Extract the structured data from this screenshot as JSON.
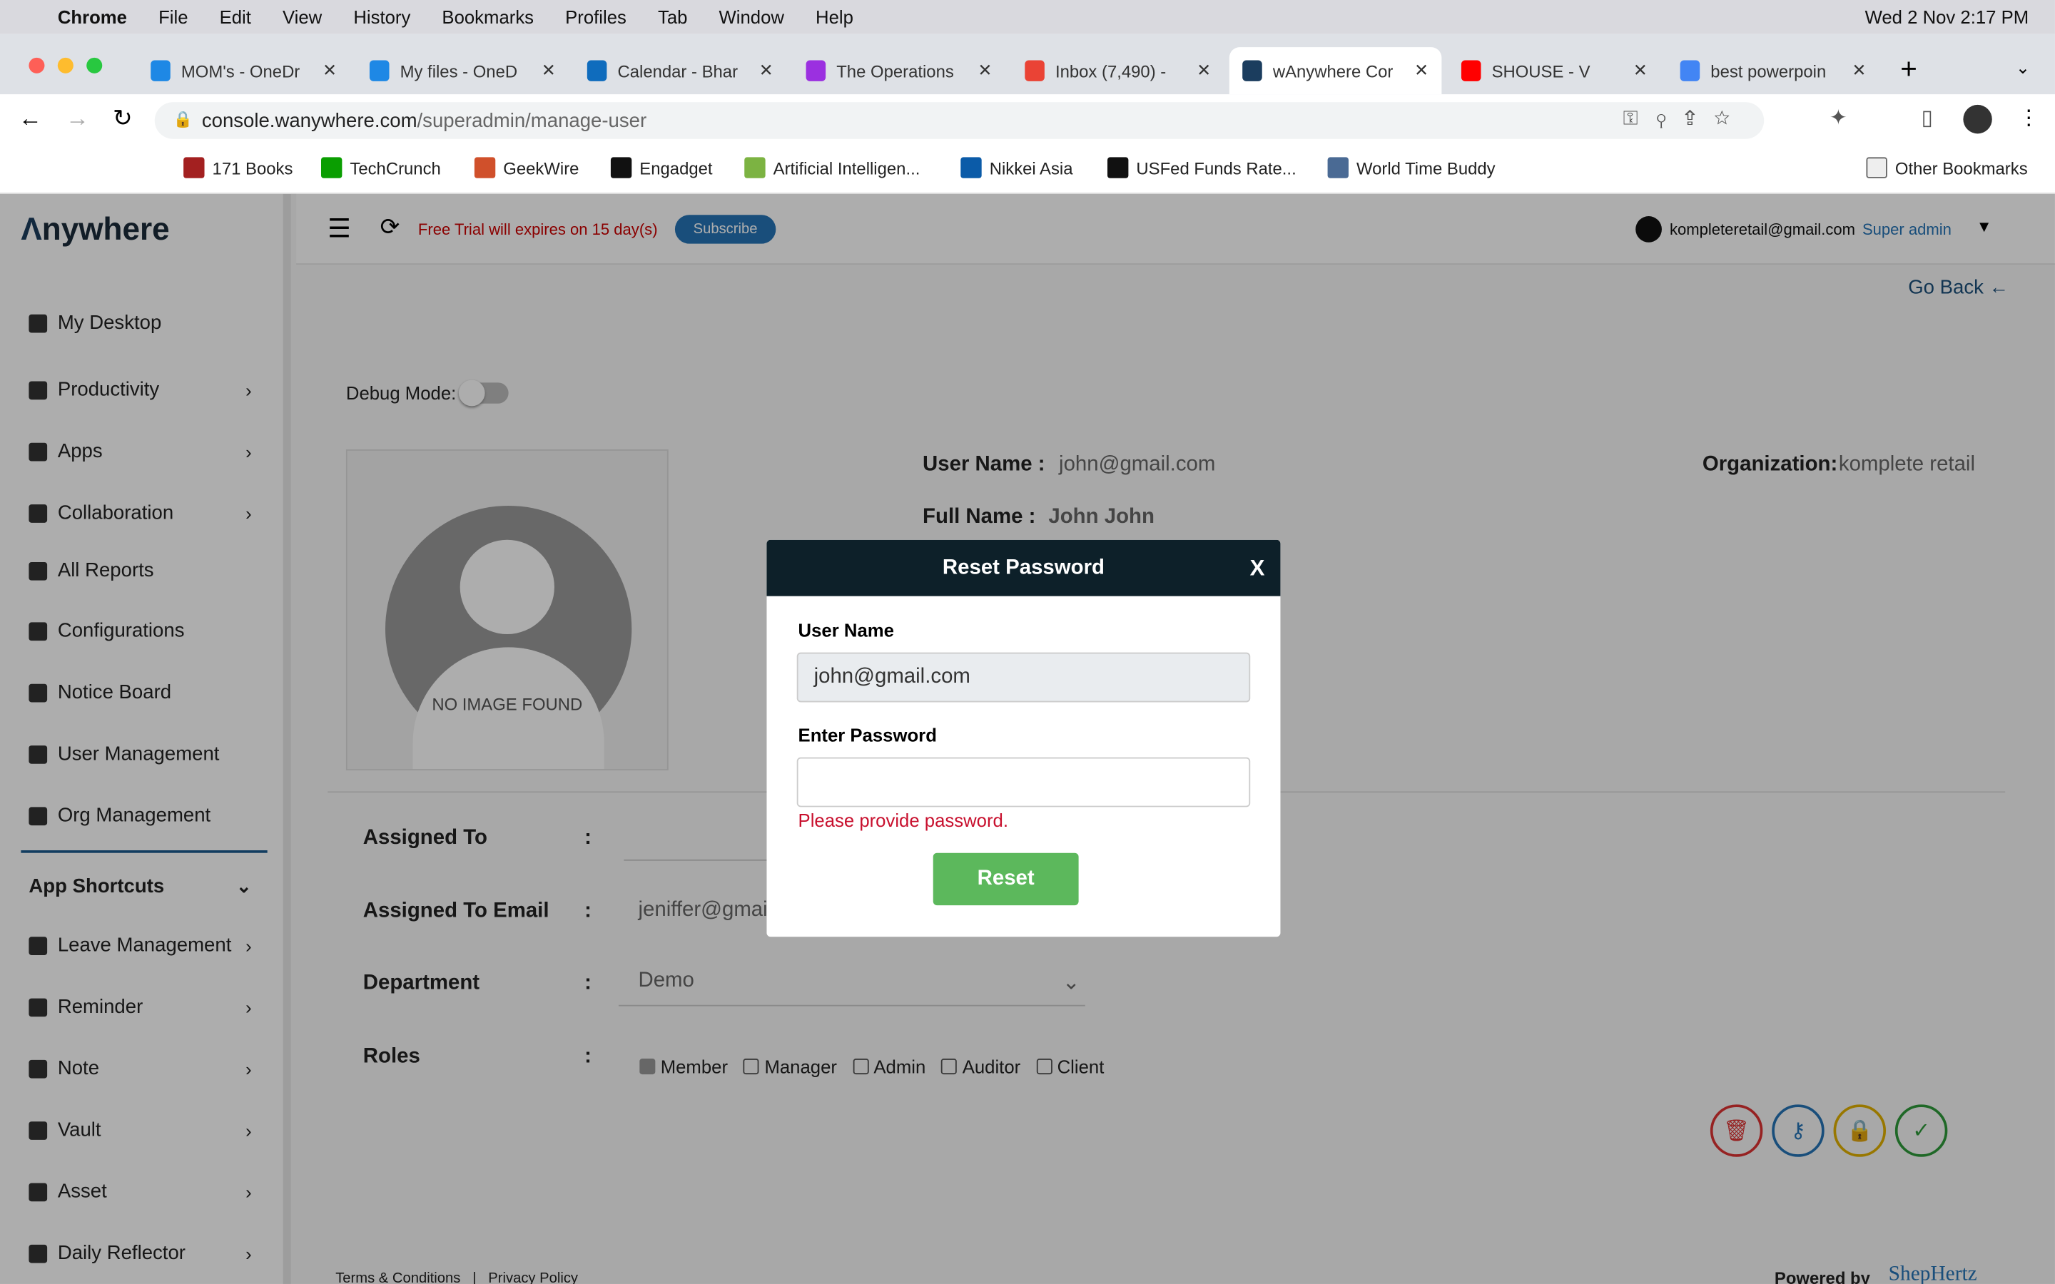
{
  "menubar": {
    "app": "Chrome",
    "items": [
      "File",
      "Edit",
      "View",
      "History",
      "Bookmarks",
      "Profiles",
      "Tab",
      "Window",
      "Help"
    ],
    "clock": "Wed 2 Nov  2:17 PM"
  },
  "tabs": [
    {
      "title": "MOM's - OneDr",
      "color": "#1e88e5"
    },
    {
      "title": "My files - OneD",
      "color": "#1e88e5"
    },
    {
      "title": "Calendar - Bhar",
      "color": "#0f6cbd"
    },
    {
      "title": "The Operations",
      "color": "#9b30e0"
    },
    {
      "title": "Inbox (7,490) -",
      "color": "#ea4335"
    },
    {
      "title": "wAnywhere Cor",
      "color": "#1b3d5e"
    },
    {
      "title": "SHOUSE - V",
      "color": "#ff0000"
    },
    {
      "title": "best powerpoin",
      "color": "#4285f4"
    }
  ],
  "url": {
    "host": "console.wanywhere.com",
    "path": "/superadmin/manage-user"
  },
  "bookmarks": [
    {
      "label": "171 Books",
      "color": "#a32020"
    },
    {
      "label": "TechCrunch",
      "color": "#0a9e01"
    },
    {
      "label": "GeekWire",
      "color": "#d0502b"
    },
    {
      "label": "Engadget",
      "color": "#111"
    },
    {
      "label": "Artificial Intelligen...",
      "color": "#7cb342"
    },
    {
      "label": "Nikkei Asia",
      "color": "#0b5ba8"
    },
    {
      "label": "USFed Funds Rate...",
      "color": "#111"
    },
    {
      "label": "World Time Buddy",
      "color": "#4a6a94"
    }
  ],
  "other_bookmarks": "Other Bookmarks",
  "app": {
    "logo": "nywhere",
    "trial": "Free Trial will expires on 15 day(s)",
    "subscribe": "Subscribe",
    "user_email": "kompleteretail@gmail.com",
    "user_role": "Super admin",
    "go_back": "Go Back",
    "debug_label": "Debug Mode:",
    "no_image": "NO IMAGE FOUND",
    "user_name_label": "User Name :",
    "user_name": "john@gmail.com",
    "full_name_label": "Full Name :",
    "full_name": "John John",
    "org_label": "Organization:",
    "org": "komplete retail",
    "assigned_to_label": "Assigned To",
    "assigned_email_label": "Assigned To Email",
    "assigned_email": "jeniffer@gmail",
    "department_label": "Department",
    "department": "Demo",
    "roles_label": "Roles",
    "colon": ":",
    "roles": [
      {
        "label": "Member",
        "checked": true
      },
      {
        "label": "Manager",
        "checked": false
      },
      {
        "label": "Admin",
        "checked": false
      },
      {
        "label": "Auditor",
        "checked": false
      },
      {
        "label": "Client",
        "checked": false
      }
    ],
    "footer_links": "Terms & Conditions   |   Privacy Policy",
    "powered_by": "Powered by",
    "powered_brand": "ShepHertz"
  },
  "sidebar": {
    "items": [
      {
        "label": "My Desktop"
      },
      {
        "label": "Productivity"
      },
      {
        "label": "Apps"
      },
      {
        "label": "Collaboration"
      },
      {
        "label": "All Reports"
      },
      {
        "label": "Configurations"
      },
      {
        "label": "Notice Board"
      },
      {
        "label": "User Management"
      },
      {
        "label": "Org Management"
      }
    ],
    "shortcuts_title": "App Shortcuts",
    "shortcuts": [
      {
        "label": "Leave Management"
      },
      {
        "label": "Reminder"
      },
      {
        "label": "Note"
      },
      {
        "label": "Vault"
      },
      {
        "label": "Asset"
      },
      {
        "label": "Daily Reflector"
      }
    ]
  },
  "modal": {
    "title": "Reset Password",
    "close": "X",
    "username_label": "User Name",
    "username_value": "john@gmail.com",
    "password_label": "Enter Password",
    "password_value": "",
    "error": "Please provide password.",
    "reset": "Reset"
  }
}
